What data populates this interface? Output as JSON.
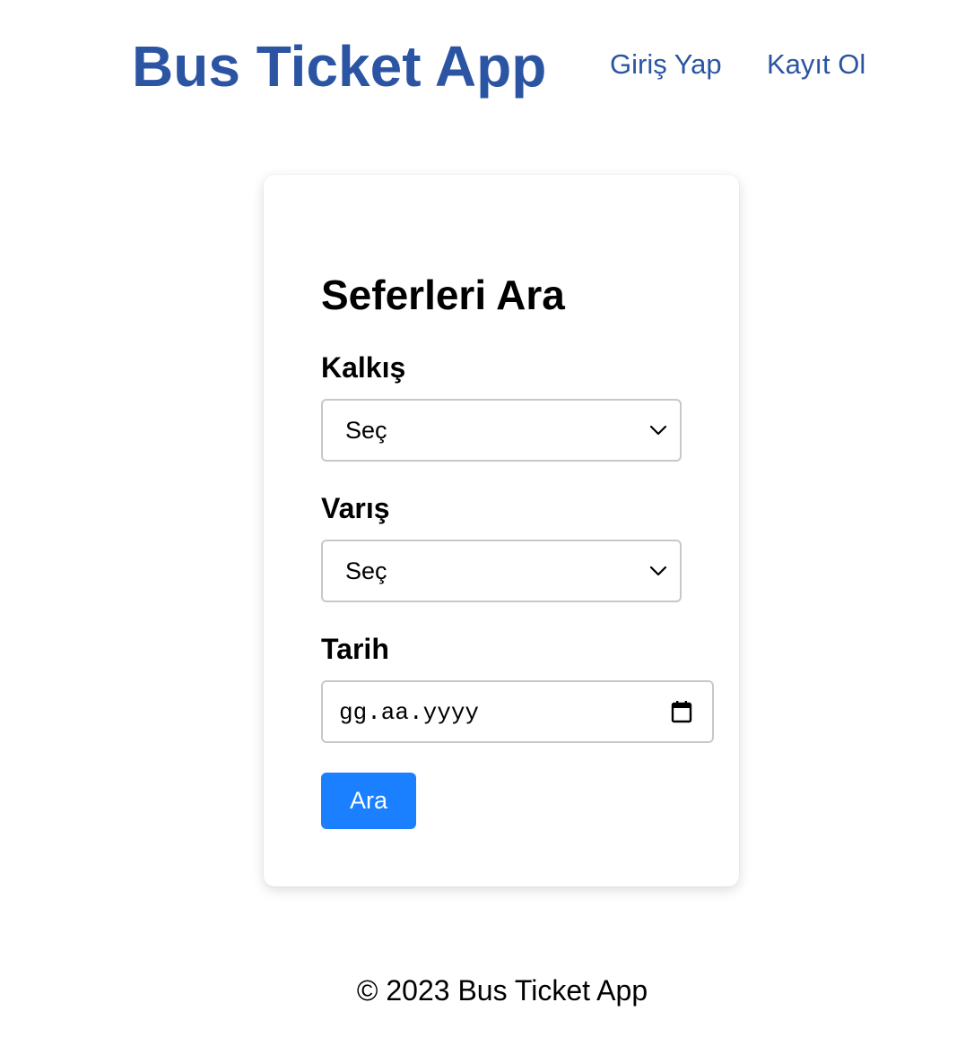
{
  "header": {
    "title": "Bus Ticket App",
    "nav": {
      "login_label": "Giriş Yap",
      "register_label": "Kayıt Ol"
    }
  },
  "search_form": {
    "title": "Seferleri Ara",
    "departure": {
      "label": "Kalkış",
      "selected": "Seç"
    },
    "arrival": {
      "label": "Varış",
      "selected": "Seç"
    },
    "date": {
      "label": "Tarih",
      "placeholder": "gg.aa.yyyy"
    },
    "submit_label": "Ara"
  },
  "footer": {
    "copyright": "© 2023 Bus Ticket App"
  },
  "colors": {
    "brand": "#2b55a3",
    "button": "#1a80ff",
    "input_border": "#c8c8c8"
  },
  "icons": {
    "select_arrow": "chevron-down-icon",
    "date_picker": "calendar-icon"
  }
}
